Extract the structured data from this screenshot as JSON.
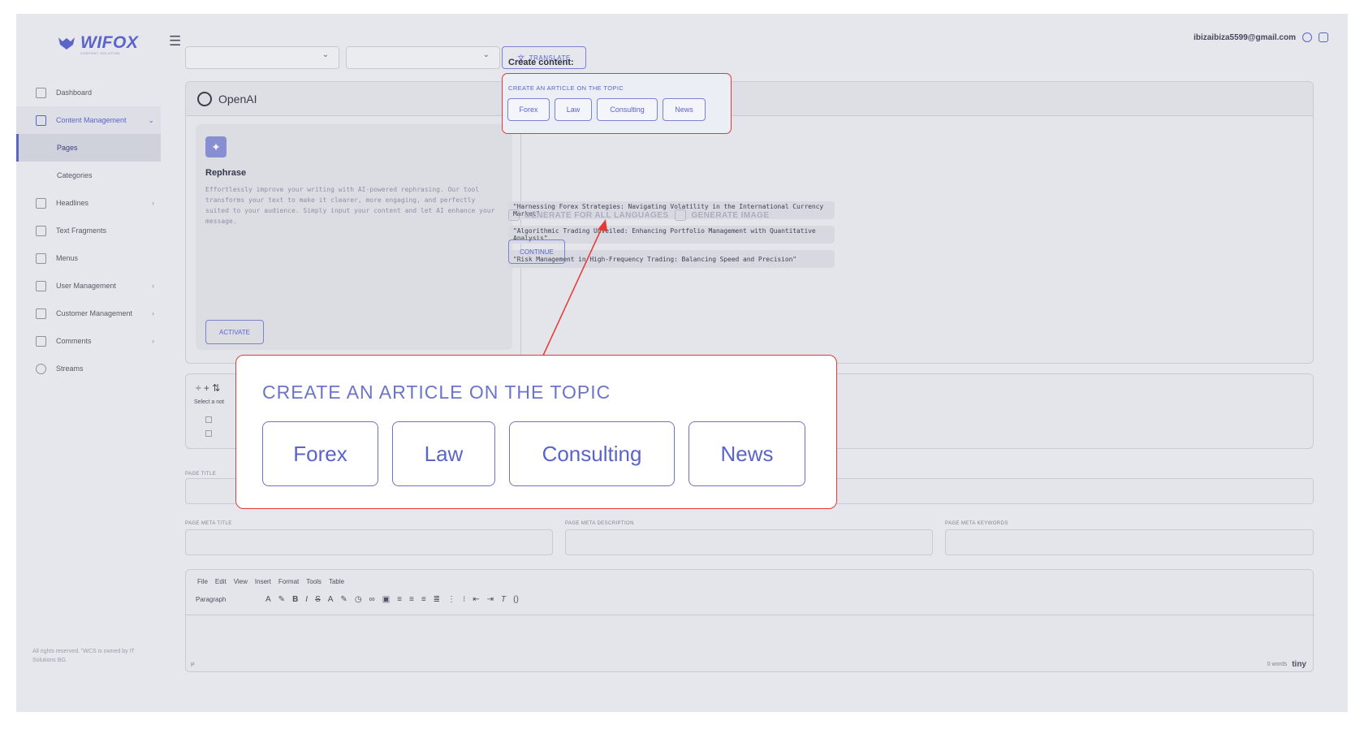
{
  "app": {
    "logo_text": "WIFOX",
    "logo_sub": "CONTENT SOLUTION",
    "footer": "All rights reserved. \"WCS is owned by IT Solutions BG."
  },
  "sidebar": {
    "items": [
      {
        "label": "Dashboard",
        "icon": "grid-icon"
      },
      {
        "label": "Content Management",
        "icon": "content-icon"
      },
      {
        "label": "Pages"
      },
      {
        "label": "Categories"
      },
      {
        "label": "Headlines",
        "icon": "headline-icon"
      },
      {
        "label": "Text Fragments",
        "icon": "text-icon"
      },
      {
        "label": "Menus",
        "icon": "menu-icon"
      },
      {
        "label": "User Management",
        "icon": "users-icon"
      },
      {
        "label": "Customer Management",
        "icon": "customer-icon"
      },
      {
        "label": "Comments",
        "icon": "comments-icon"
      },
      {
        "label": "Streams",
        "icon": "streams-icon"
      }
    ]
  },
  "header": {
    "email": "ibizaibiza5599@gmail.com"
  },
  "toolbar": {
    "translate_label": "TRANSLATE"
  },
  "openai": {
    "title": "OpenAI",
    "rephrase": {
      "title": "Rephrase",
      "description": "Effortlessly improve your writing with AI-powered rephrasing. Our tool transforms your text to make it clearer, more engaging, and perfectly suited to your audience. Simply input your content and let AI enhance your message.",
      "activate_label": "ACTIVATE"
    },
    "create_label": "Create content:",
    "topic_label": "CREATE AN ARTICLE ON THE TOPIC",
    "topics": [
      "Forex",
      "Law",
      "Consulting",
      "News"
    ],
    "suggestions": [
      "\"Harnessing Forex Strategies: Navigating Volatility in the International Currency Market\"",
      "\"Algorithmic Trading Unveiled: Enhancing Portfolio Management with Quantitative Analysis\"",
      "\"Risk Management in High-Frequency Trading: Balancing Speed and Precision\""
    ],
    "generate_all_label": "GENERATE FOR ALL LANGUAGES",
    "generate_image_label": "GENERATE IMAGE",
    "continue_label": "CONTINUE"
  },
  "tree": {
    "hint": "Select a not"
  },
  "fields": {
    "page_title": "PAGE TITLE",
    "meta_title": "PAGE META TITLE",
    "meta_description": "PAGE META DESCRIPTION",
    "meta_keywords": "PAGE META KEYWORDS"
  },
  "editor": {
    "menu": [
      "File",
      "Edit",
      "View",
      "Insert",
      "Format",
      "Tools",
      "Table"
    ],
    "paragraph": "Paragraph",
    "status": "P",
    "word_count": "0 words",
    "brand": "tiny"
  },
  "zoom": {
    "label": "CREATE AN ARTICLE ON THE TOPIC",
    "topics": [
      "Forex",
      "Law",
      "Consulting",
      "News"
    ]
  },
  "colors": {
    "accent": "#5b64c9",
    "highlight": "#e53935"
  }
}
